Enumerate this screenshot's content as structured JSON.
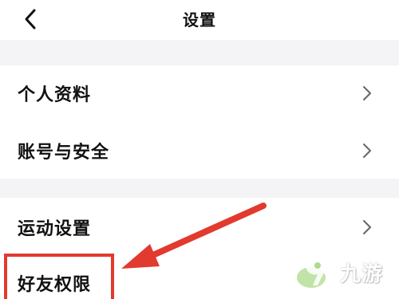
{
  "header": {
    "title": "设置",
    "back_icon": "chevron-left-icon"
  },
  "settings": {
    "group1": [
      {
        "label": "个人资料",
        "icon": "chevron-right-icon"
      },
      {
        "label": "账号与安全",
        "icon": "chevron-right-icon"
      }
    ],
    "group2": [
      {
        "label": "运动设置",
        "icon": "chevron-right-icon"
      },
      {
        "label": "好友权限",
        "icon": "chevron-right-icon"
      }
    ]
  },
  "annotation": {
    "color": "#e23a2e"
  },
  "watermark": {
    "text": "九游",
    "logo_color": "#7cc242"
  }
}
